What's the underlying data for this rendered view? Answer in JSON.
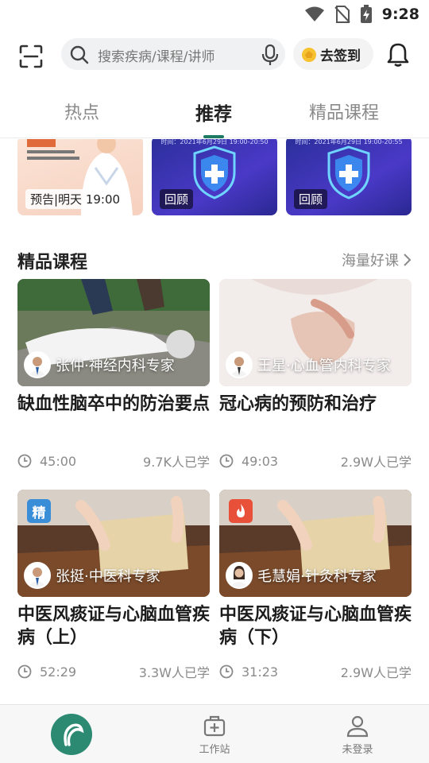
{
  "status_bar": {
    "time": "9:28"
  },
  "header": {
    "search_placeholder": "搜索疾病/课程/讲师",
    "checkin_label": "去签到"
  },
  "tabs": [
    {
      "label": "热点",
      "active": false
    },
    {
      "label": "推荐",
      "active": true
    },
    {
      "label": "精品课程",
      "active": false
    }
  ],
  "live_cards": [
    {
      "badge": "预告|明天 19:00",
      "style": "doctor"
    },
    {
      "badge": "回顾",
      "subtext": "时间：2021年6月29日 19:00-20:50",
      "style": "shield"
    },
    {
      "badge": "回顾",
      "subtext": "时间：2021年6月29日 19:00-20:55",
      "style": "shield"
    }
  ],
  "section": {
    "title": "精品课程",
    "more_label": "海量好课"
  },
  "courses": [
    {
      "teacher": "张仲·神经内科专家",
      "title": "缺血性脑卒中的防治要点",
      "duration": "45:00",
      "learners": "9.7K人已学",
      "corner": ""
    },
    {
      "teacher": "王星·心血管内科专家",
      "title": "冠心病的预防和治疗",
      "duration": "49:03",
      "learners": "2.9W人已学",
      "corner": ""
    },
    {
      "teacher": "张挺·中医科专家",
      "title": "中医风痰证与心脑血管疾病（上）",
      "duration": "52:29",
      "learners": "3.3W人已学",
      "corner": "精"
    },
    {
      "teacher": "毛慧娟·针灸科专家",
      "title": "中医风痰证与心脑血管疾病（下）",
      "duration": "31:23",
      "learners": "2.9W人已学",
      "corner": "fire"
    }
  ],
  "bottom_nav": [
    {
      "label": "",
      "icon": "home-logo-icon"
    },
    {
      "label": "工作站",
      "icon": "medical-kit-icon"
    },
    {
      "label": "未登录",
      "icon": "person-icon"
    }
  ],
  "colors": {
    "accent": "#1f7a63",
    "brand": "#2c8a72"
  }
}
